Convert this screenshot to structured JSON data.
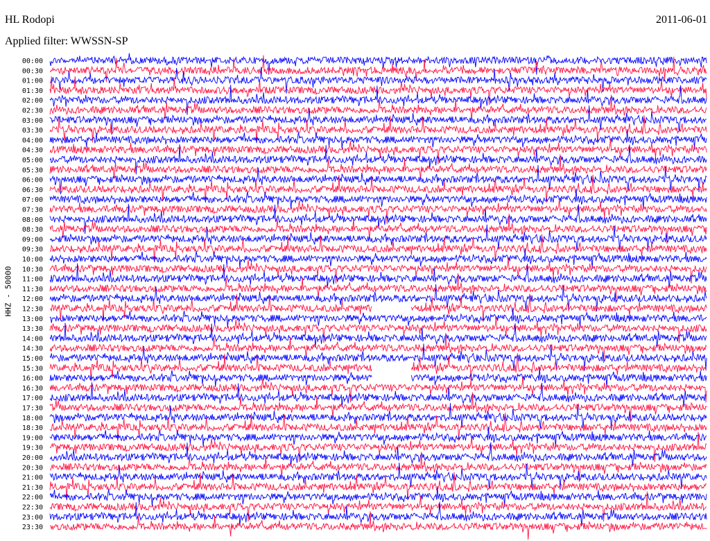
{
  "header": {
    "station": "HL Rodopi",
    "date": "2011-06-01",
    "filter": "Applied filter: WWSSN-SP"
  },
  "channel_label": "HHZ - 50000",
  "chart_data": {
    "type": "line",
    "title": "HL Rodopi",
    "subtitle": "Applied filter: WWSSN-SP",
    "date": "2011-06-01",
    "ylabel": "HHZ - 50000",
    "xlabel": "",
    "grid": false,
    "line_start_times": [
      "00:00",
      "00:30",
      "01:00",
      "01:30",
      "02:00",
      "02:30",
      "03:00",
      "03:30",
      "04:00",
      "04:30",
      "05:00",
      "05:30",
      "06:00",
      "06:30",
      "07:00",
      "07:30",
      "08:00",
      "08:30",
      "09:00",
      "09:30",
      "10:00",
      "10:30",
      "11:00",
      "11:30",
      "12:00",
      "12:30",
      "13:00",
      "13:30",
      "14:00",
      "14:30",
      "15:00",
      "15:30",
      "16:00",
      "16:30",
      "17:00",
      "17:30",
      "18:00",
      "18:30",
      "19:00",
      "19:30",
      "20:00",
      "20:30",
      "21:00",
      "21:30",
      "22:00",
      "22:30",
      "23:00",
      "23:30"
    ],
    "trace_colors": [
      "#0000ff",
      "#ff1040"
    ],
    "data_gaps": [
      {
        "line": "12:30",
        "start_fraction": 0.49,
        "end_fraction": 0.55
      },
      {
        "line": "15:30",
        "start_fraction": 0.49,
        "end_fraction": 0.55
      },
      {
        "line": "16:00",
        "start_fraction": 0.49,
        "end_fraction": 0.55
      }
    ]
  }
}
